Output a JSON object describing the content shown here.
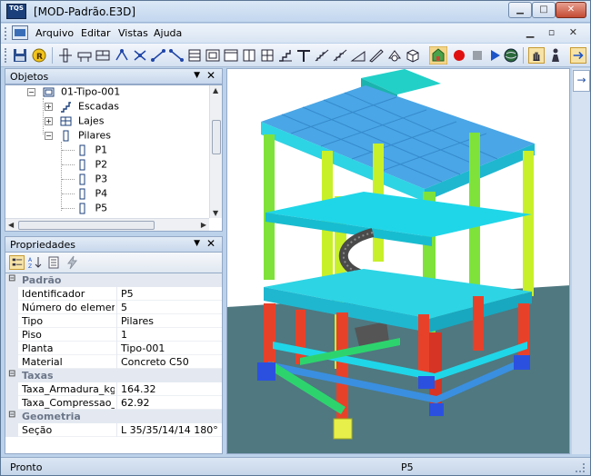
{
  "window": {
    "app_icon_text": "TQS",
    "title": "[MOD-Padrão.E3D]",
    "min_glyph": "▁",
    "max_glyph": "□",
    "close_glyph": "✕"
  },
  "menu": {
    "items": [
      {
        "label": "Arquivo"
      },
      {
        "label": "Editar"
      },
      {
        "label": "Vistas"
      },
      {
        "label": "Ajuda"
      }
    ],
    "mdi_controls": "▁ ▫ ✕"
  },
  "toolbar": {
    "buttons": [
      "save-icon",
      "render-icon",
      "pillar-icon",
      "beam-icon",
      "wall-icon",
      "node-icon",
      "node2-icon",
      "node3-icon",
      "node4-icon",
      "slab-icon",
      "frame-icon",
      "window-icon",
      "box-icon",
      "view-icon",
      "stairs-icon",
      "tee-icon",
      "steps-icon",
      "steps2-icon",
      "ramp-icon",
      "ramp2-icon",
      "shape-icon",
      "cube-icon",
      "record-icon",
      "stop-icon",
      "play-icon",
      "globe-icon",
      "hand-icon",
      "person-icon",
      "arrow-icon"
    ],
    "colors": {
      "record": "#e01010",
      "play": "#1d55c8"
    }
  },
  "objetos": {
    "title": "Objetos",
    "pin_glyph": "▼",
    "close_glyph": "✕",
    "tree": [
      {
        "label": "01-Tipo-001",
        "expander": "−",
        "icon": "floor-icon",
        "level": 0
      },
      {
        "label": "Escadas",
        "expander": "+",
        "icon": "stairs-icon",
        "level": 1
      },
      {
        "label": "Lajes",
        "expander": "+",
        "icon": "slab-icon",
        "level": 1
      },
      {
        "label": "Pilares",
        "expander": "−",
        "icon": "pillar-icon",
        "level": 1
      },
      {
        "label": "P1",
        "expander": "",
        "icon": "pillar-icon",
        "level": 2
      },
      {
        "label": "P2",
        "expander": "",
        "icon": "pillar-icon",
        "level": 2
      },
      {
        "label": "P3",
        "expander": "",
        "icon": "pillar-icon",
        "level": 2
      },
      {
        "label": "P4",
        "expander": "",
        "icon": "pillar-icon",
        "level": 2
      },
      {
        "label": "P5",
        "expander": "",
        "icon": "pillar-icon",
        "level": 2
      }
    ]
  },
  "propriedades": {
    "title": "Propriedades",
    "pin_glyph": "▼",
    "close_glyph": "✕",
    "categories": [
      {
        "name": "Padrão",
        "toggle": "⊟",
        "rows": [
          {
            "key": "Identificador",
            "value": "P5"
          },
          {
            "key": "Número do elemento",
            "value": "5"
          },
          {
            "key": "Tipo",
            "value": "Pilares"
          },
          {
            "key": "Piso",
            "value": "1"
          },
          {
            "key": "Planta",
            "value": "Tipo-001"
          },
          {
            "key": "Material",
            "value": "Concreto C50"
          }
        ]
      },
      {
        "name": "Taxas",
        "toggle": "⊟",
        "rows": [
          {
            "key": "Taxa_Armadura_kgf...",
            "value": "164.32"
          },
          {
            "key": "Taxa_Compressao_...",
            "value": "62.92"
          }
        ]
      },
      {
        "name": "Geometria",
        "toggle": "⊟",
        "rows": [
          {
            "key": "Seção",
            "value": "L 35/35/14/14 180°"
          }
        ]
      }
    ]
  },
  "viewport": {
    "colors": {
      "sky": "#ffffff",
      "ground": "#4f7880",
      "slab_top": "#4aa6e6",
      "slab_edge": "#2dd4e4",
      "beam_cyan": "#1fd6e8",
      "beam_blue": "#3a8fe0",
      "pillar_lime": "#c8f029",
      "pillar_green": "#7fe23a",
      "pillar_red": "#e8412a",
      "footing_blue": "#2b50e0",
      "footing_yellow": "#e7f04a",
      "roof_box": "#22d0c8",
      "stairs": "#4a4a4a"
    }
  },
  "side_rail": {
    "arrow_glyph": "→"
  },
  "status": {
    "left": "Pronto",
    "center": "P5"
  }
}
